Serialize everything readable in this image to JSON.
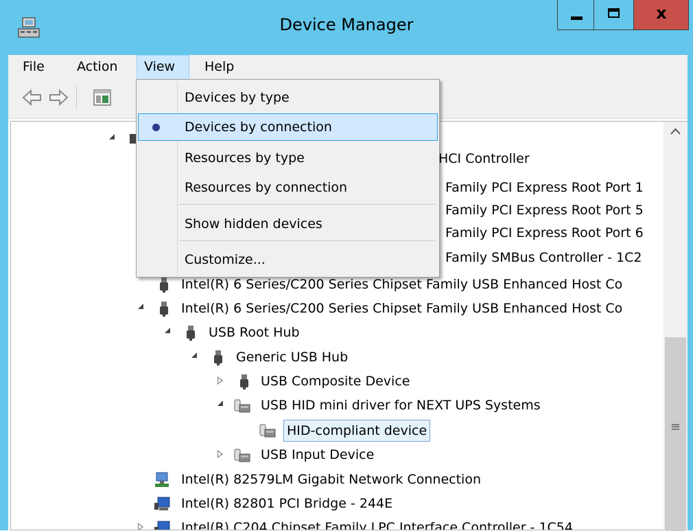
{
  "window": {
    "title": "Device Manager",
    "close_glyph": "x"
  },
  "menu": {
    "file": "File",
    "action": "Action",
    "view": "View",
    "help": "Help"
  },
  "view_menu": {
    "items": [
      "Devices by type",
      "Devices by connection",
      "Resources by type",
      "Resources by connection",
      "Show hidden devices",
      "Customize..."
    ],
    "selected": "Devices by connection"
  },
  "tree": {
    "partial_rows": [
      "HCI Controller",
      "Family PCI Express Root Port 1",
      "Family PCI Express Root Port 5",
      "Family PCI Express Root Port 6",
      "Family SMBus Controller - 1C2"
    ],
    "rows": [
      "Intel(R) 6 Series/C200 Series Chipset Family USB Enhanced Host Co",
      "Intel(R) 6 Series/C200 Series Chipset Family USB Enhanced Host Co",
      "USB Root Hub",
      "Generic USB Hub",
      "USB Composite Device",
      "USB HID mini driver for NEXT UPS Systems",
      "HID-compliant device",
      "USB Input Device",
      "Intel(R) 82579LM Gigabit Network Connection",
      "Intel(R) 82801 PCI Bridge - 244E",
      "Intel(R) C204 Chipset Family LPC Interface Controller - 1C54"
    ],
    "selected": "HID-compliant device"
  },
  "icons": {
    "app": "device-manager-icon",
    "back": "back-arrow-icon",
    "forward": "forward-arrow-icon",
    "properties": "properties-icon",
    "usb": "usb-plug-icon",
    "hid": "hid-device-icon",
    "network": "network-adapter-icon",
    "bridge": "pci-bridge-icon"
  },
  "scrollbar": {
    "up_glyph": "^",
    "grip_glyph": "≡"
  }
}
